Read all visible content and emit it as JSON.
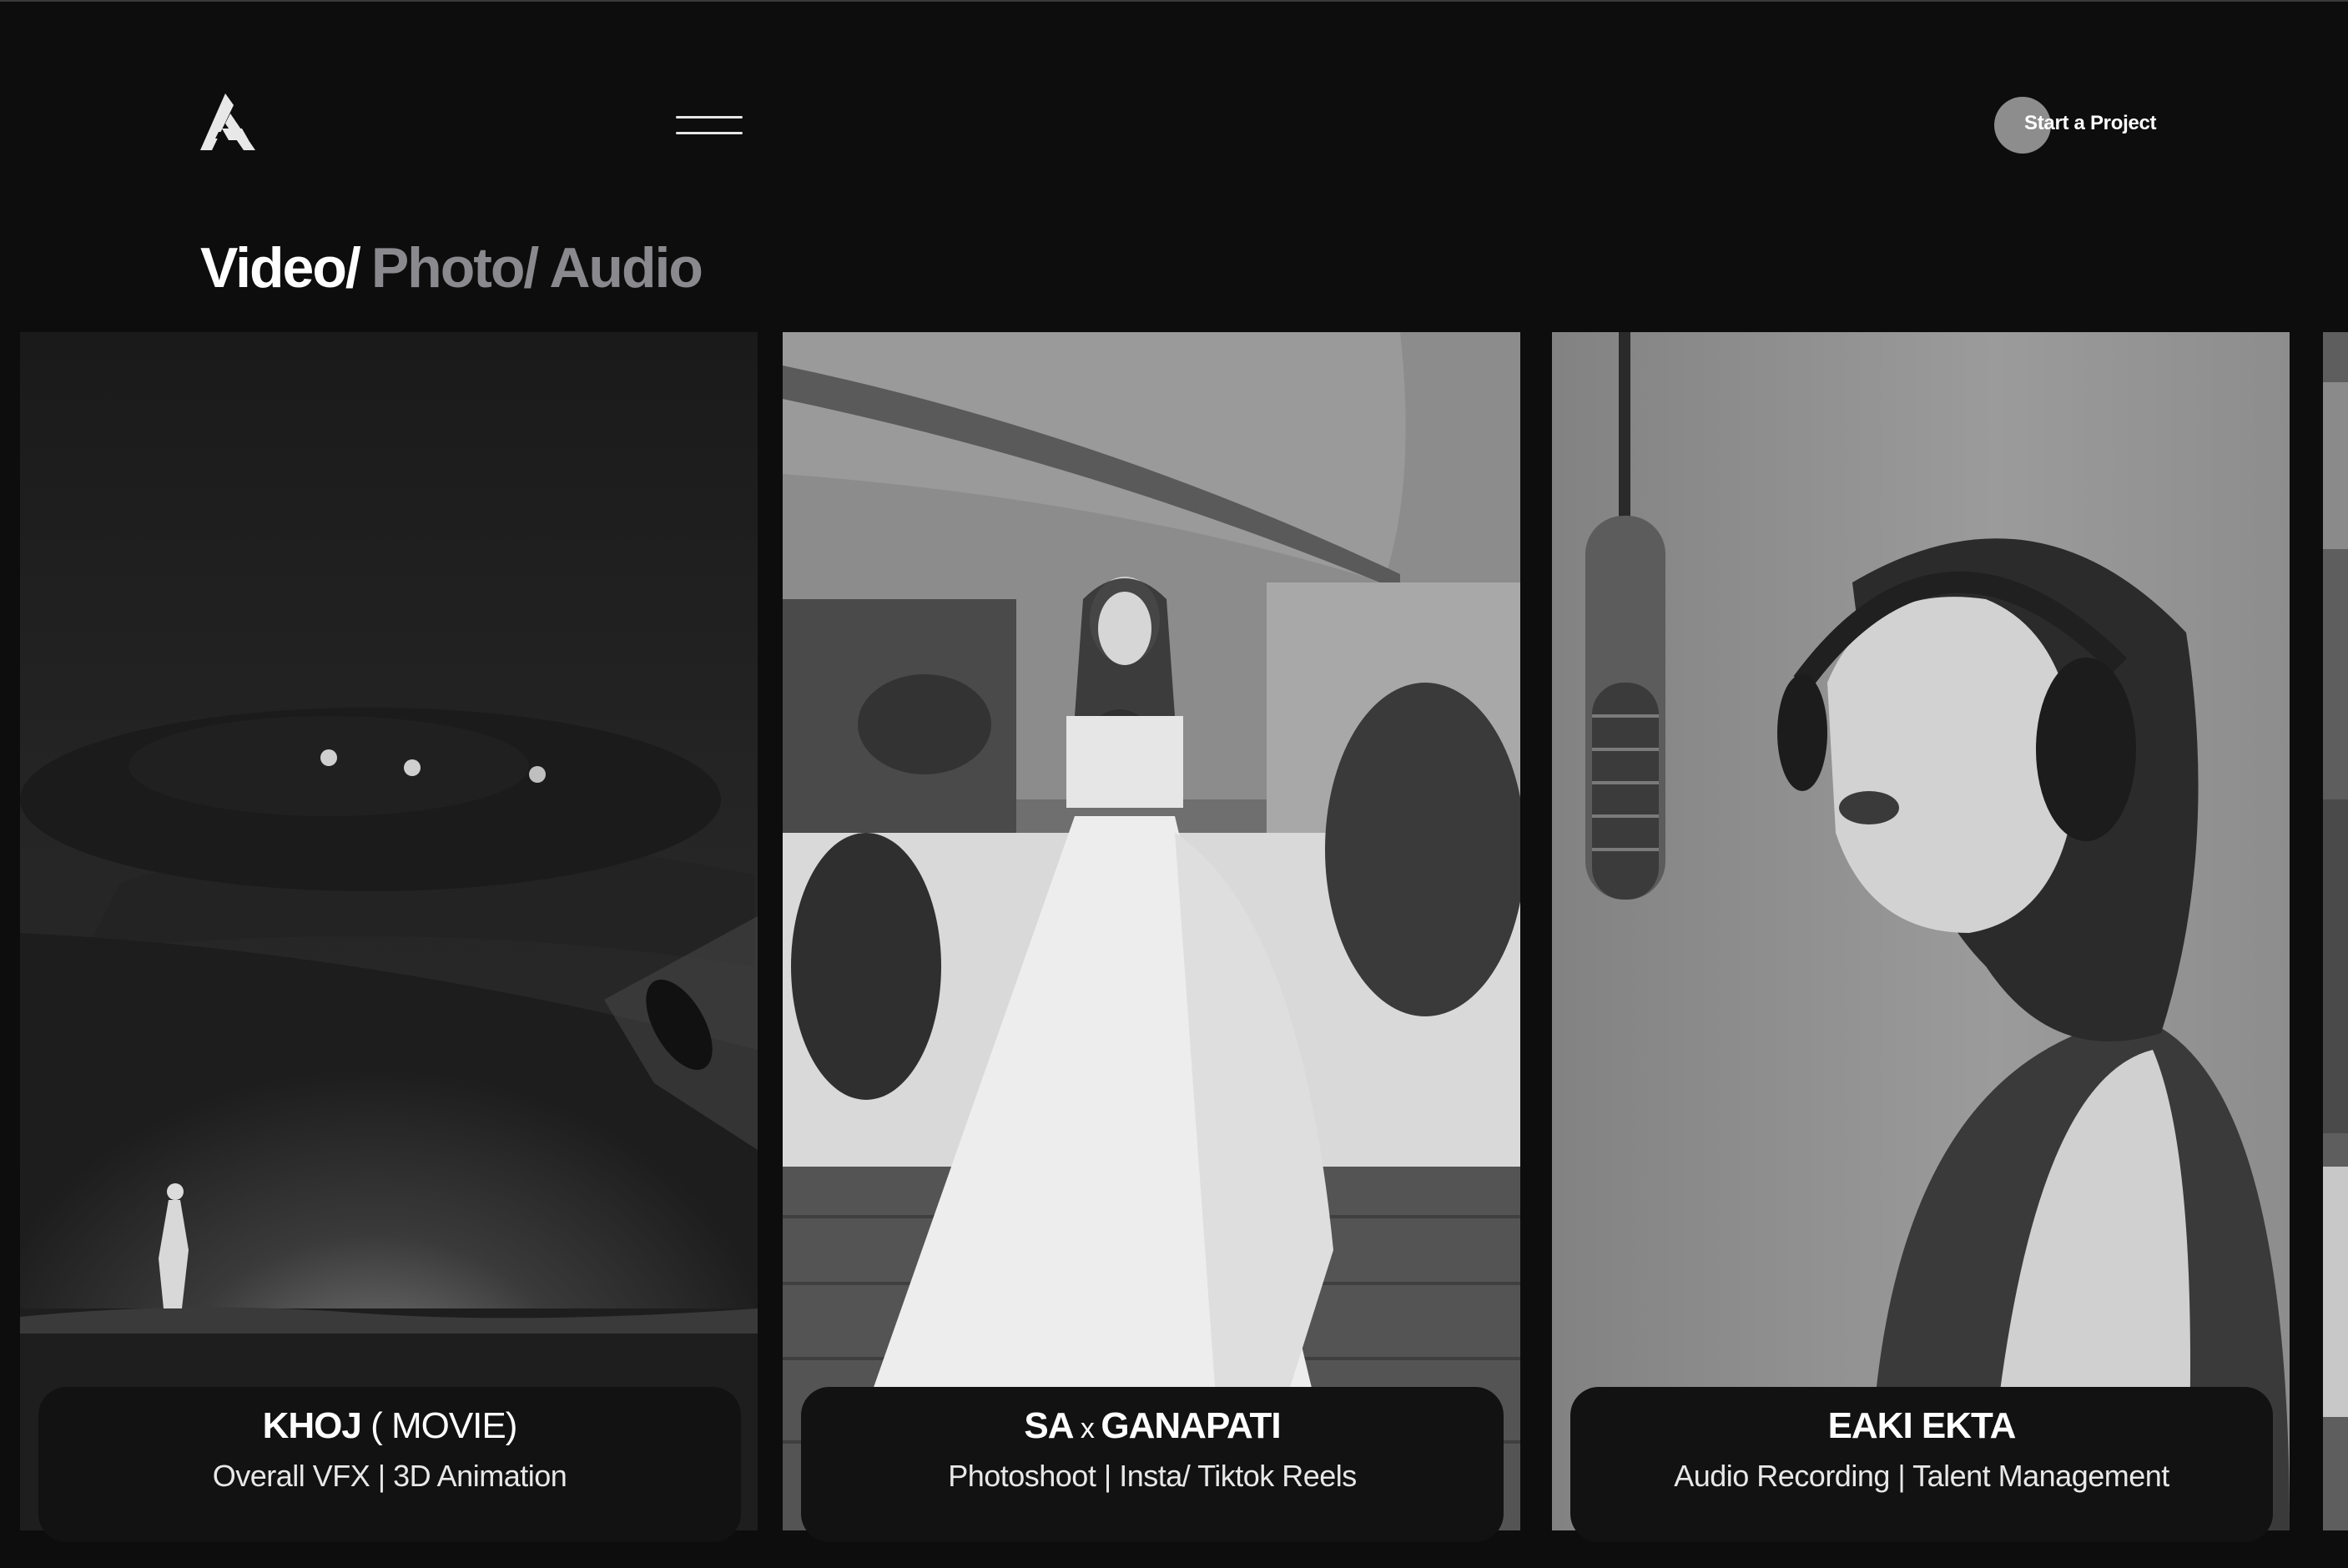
{
  "header": {
    "cta_label": "Start a Project"
  },
  "categories": [
    {
      "label": "Video/",
      "active": true
    },
    {
      "label": "Photo/",
      "active": false
    },
    {
      "label": "Audio",
      "active": false
    }
  ],
  "cards": [
    {
      "title_main": "KHOJ",
      "title_sep": " ",
      "title_light": "( MOVIE)",
      "subtitle": "Overall VFX | 3D Animation"
    },
    {
      "title_main": "SA",
      "title_sep": " x ",
      "title_light_bold": "GANAPATI",
      "subtitle": "Photoshoot | Insta/ Tiktok Reels"
    },
    {
      "title_main": "EAKI EKTA",
      "subtitle": "Audio Recording | Talent Management"
    }
  ],
  "colors": {
    "background": "#0d0d0e",
    "active_category": "#ffffff",
    "muted_category": "#8a8a8e",
    "card_info_bg": "#121212",
    "cta_dot": "#8d8d8d"
  }
}
